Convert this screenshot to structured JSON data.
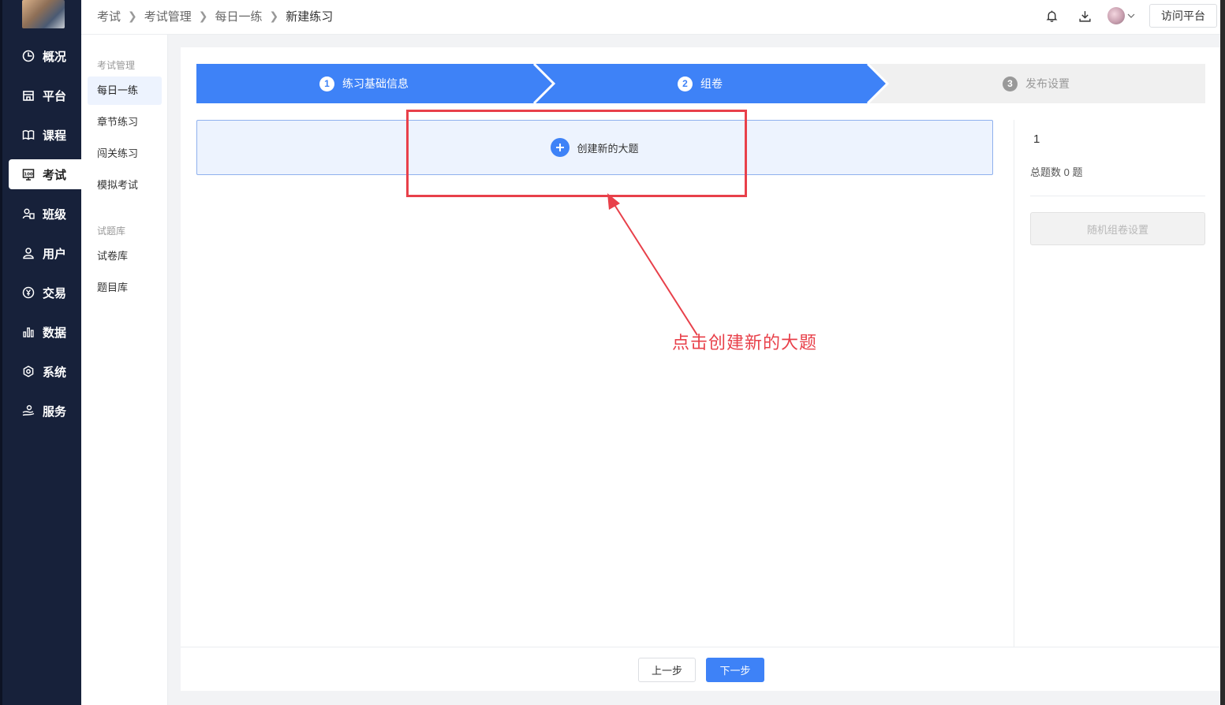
{
  "colors": {
    "nav_bg": "#17213a",
    "primary": "#3e82f7",
    "annotation": "#e8404a",
    "step_inactive": "#f0f0f0"
  },
  "left_nav": {
    "items": [
      {
        "label": "概况",
        "icon": "clock-pie-icon"
      },
      {
        "label": "平台",
        "icon": "store-icon"
      },
      {
        "label": "课程",
        "icon": "book-icon"
      },
      {
        "label": "考试",
        "icon": "exam-score-icon",
        "active": true
      },
      {
        "label": "班级",
        "icon": "group-icon"
      },
      {
        "label": "用户",
        "icon": "user-icon"
      },
      {
        "label": "交易",
        "icon": "yen-circle-icon"
      },
      {
        "label": "数据",
        "icon": "bar-chart-icon"
      },
      {
        "label": "系统",
        "icon": "gear-icon"
      },
      {
        "label": "服务",
        "icon": "service-hand-icon"
      }
    ]
  },
  "sub_nav": {
    "group1": "考试管理",
    "group1_items": [
      "每日一练",
      "章节练习",
      "闯关练习",
      "模拟考试"
    ],
    "group2": "试题库",
    "group2_items": [
      "试卷库",
      "题目库"
    ]
  },
  "breadcrumb": [
    "考试",
    "考试管理",
    "每日一练",
    "新建练习"
  ],
  "header": {
    "visit_label": "访问平台"
  },
  "steps": [
    {
      "num": "1",
      "label": "练习基础信息",
      "state": "done"
    },
    {
      "num": "2",
      "label": "组卷",
      "state": "current"
    },
    {
      "num": "3",
      "label": "发布设置",
      "state": "todo"
    }
  ],
  "main": {
    "create_label": "创建新的大题"
  },
  "right_panel": {
    "number": "1",
    "count_label": "总题数 0 题",
    "random_button": "随机组卷设置"
  },
  "footer": {
    "prev_label": "上一步",
    "next_label": "下一步"
  },
  "annotation": {
    "text": "点击创建新的大题"
  }
}
